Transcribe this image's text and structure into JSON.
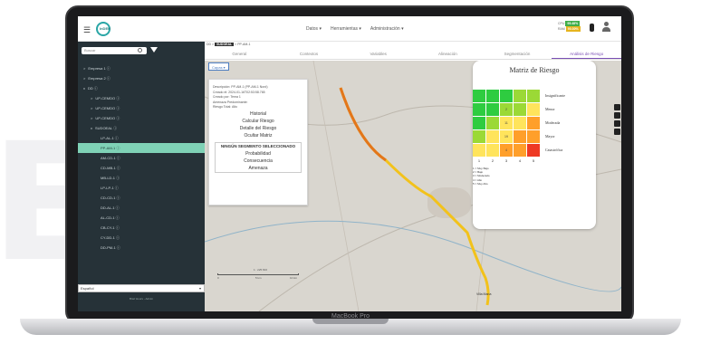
{
  "device": {
    "label": "MacBook Pro"
  },
  "topbar": {
    "logo_text": "InDEH",
    "nav": [
      "Datos ▾",
      "Herramientas ▾",
      "Administración ▾"
    ],
    "status_cpu_label": "CPU",
    "status_cpu_badge": "95.48%",
    "status_ram_label": "RAM",
    "status_ram_badge": "90.30%"
  },
  "sidebar": {
    "search_placeholder": "Buscar",
    "items": [
      {
        "label": "Empresa 1 ⓘ",
        "indent": 0,
        "caret": ">"
      },
      {
        "label": "Empresa 2 ⓘ",
        "indent": 0,
        "caret": ">"
      },
      {
        "label": "DD ⓘ",
        "indent": 0,
        "caret": "v"
      },
      {
        "label": "UP-CEMDO ⓘ",
        "indent": 1,
        "caret": ">"
      },
      {
        "label": "UP-CEMDO ⓘ",
        "indent": 1,
        "caret": ">"
      },
      {
        "label": "UP-CEMDO ⓘ",
        "indent": 1,
        "caret": ">"
      },
      {
        "label": "SUDOEAL ⓘ",
        "indent": 1,
        "caret": "v"
      },
      {
        "label": "LP-AL-1 ⓘ",
        "indent": 2,
        "caret": ""
      },
      {
        "label": "PP-AM-1 ⓘ",
        "indent": 2,
        "caret": "",
        "selected": true
      },
      {
        "label": "AM-CD-1 ⓘ",
        "indent": 2,
        "caret": ""
      },
      {
        "label": "CD-MB-1 ⓘ",
        "indent": 2,
        "caret": ""
      },
      {
        "label": "MB-LD-1 ⓘ",
        "indent": 2,
        "caret": ""
      },
      {
        "label": "LP-LP-1 ⓘ",
        "indent": 2,
        "caret": ""
      },
      {
        "label": "CD-CD-1 ⓘ",
        "indent": 2,
        "caret": ""
      },
      {
        "label": "DD-AL-1 ⓘ",
        "indent": 2,
        "caret": ""
      },
      {
        "label": "AL-CD-1 ⓘ",
        "indent": 2,
        "caret": ""
      },
      {
        "label": "CB-CY-1 ⓘ",
        "indent": 2,
        "caret": ""
      },
      {
        "label": "CY-DD-1 ⓘ",
        "indent": 2,
        "caret": ""
      },
      {
        "label": "DD-PM-1 ⓘ",
        "indent": 2,
        "caret": ""
      }
    ],
    "language": "Español",
    "footer": "Brief Hours - Admin"
  },
  "main": {
    "breadcrumb_prefix": "DD >",
    "breadcrumb_current": "SUDOEAL",
    "breadcrumb_suffix": "> PP-AM-1",
    "tabs": [
      {
        "label": "General",
        "active": false
      },
      {
        "label": "Contextos",
        "active": false
      },
      {
        "label": "Variables",
        "active": false
      },
      {
        "label": "Alineación",
        "active": false
      },
      {
        "label": "Segmentación",
        "active": false
      },
      {
        "label": "Análisis de Riesgo",
        "active": true
      }
    ],
    "layer_button": "Capas ▾"
  },
  "info_panel": {
    "lines": [
      "Descripción: PP-AM-1 (PP-AM-1 Nord)",
      "Creado el: 2024-01-16T02:53:58.765",
      "Creado por: Tema 1",
      "Amenaza Predominante:",
      "Riesgo Total: Alto"
    ],
    "actions": [
      "Historial",
      "Calcular Riesgo",
      "Detalle del Riesgo",
      "Ocultar Matriz"
    ],
    "segment_header": "NINGÚN SEGMENTO SELECCIONADO",
    "segment_items": [
      "Probabilidad",
      "Consecuencia",
      "Amenaza"
    ]
  },
  "risk_matrix": {
    "title": "Matriz de Riesgo",
    "row_labels": [
      "Insignificante",
      "Menor",
      "Moderada",
      "Mayor",
      "Catastrófica"
    ],
    "col_labels": [
      "1",
      "2",
      "3",
      "4",
      "5"
    ],
    "cells": [
      [
        {
          "c": "#2ecc40",
          "v": ""
        },
        {
          "c": "#2ecc40",
          "v": ""
        },
        {
          "c": "#2ecc40",
          "v": ""
        },
        {
          "c": "#9bd936",
          "v": ""
        },
        {
          "c": "#9bd936",
          "v": ""
        }
      ],
      [
        {
          "c": "#2ecc40",
          "v": ""
        },
        {
          "c": "#2ecc40",
          "v": ""
        },
        {
          "c": "#9bd936",
          "v": "2"
        },
        {
          "c": "#9bd936",
          "v": ""
        },
        {
          "c": "#ffe45c",
          "v": ""
        }
      ],
      [
        {
          "c": "#2ecc40",
          "v": ""
        },
        {
          "c": "#9bd936",
          "v": ""
        },
        {
          "c": "#ffe45c",
          "v": "11"
        },
        {
          "c": "#ffe45c",
          "v": ""
        },
        {
          "c": "#ff9f2a",
          "v": ""
        }
      ],
      [
        {
          "c": "#9bd936",
          "v": ""
        },
        {
          "c": "#ffe45c",
          "v": ""
        },
        {
          "c": "#ffe45c",
          "v": "19"
        },
        {
          "c": "#ff9f2a",
          "v": ""
        },
        {
          "c": "#ff9f2a",
          "v": ""
        }
      ],
      [
        {
          "c": "#ffe45c",
          "v": ""
        },
        {
          "c": "#ffe45c",
          "v": ""
        },
        {
          "c": "#ff9f2a",
          "v": "4"
        },
        {
          "c": "#ff9f2a",
          "v": ""
        },
        {
          "c": "#ee3a24",
          "v": ""
        }
      ]
    ],
    "legend": [
      "1 = Muy Bajo",
      "2 = Bajo",
      "3 = Moderado",
      "4 = Alto",
      "5 = Muy Alto"
    ]
  },
  "map": {
    "scale_label": "1 : 225 816",
    "scale_left": "0",
    "scale_mid": "5 km",
    "scale_right": "10 km",
    "place_label": "Villa María"
  },
  "colors": {
    "sidebar_bg": "#263238",
    "selected_item": "#7fd2b6",
    "active_tab": "#7b4fb5",
    "route": "#f2c21b"
  }
}
